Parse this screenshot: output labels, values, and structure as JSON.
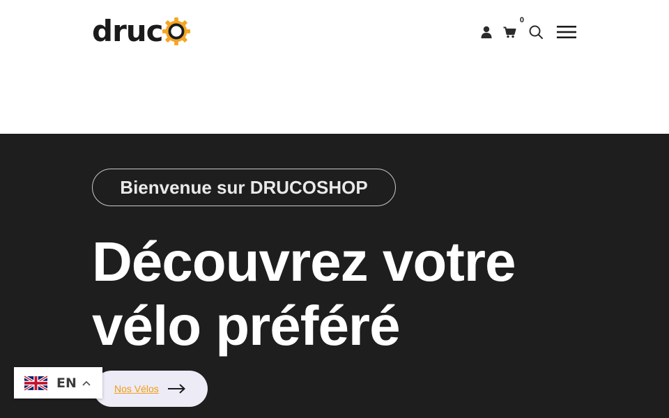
{
  "header": {
    "logo_text": "druc",
    "cart_count": "0"
  },
  "hero": {
    "welcome": "Bienvenue sur DRUCOSHOP",
    "title_line1": "Découvrez votre",
    "title_line2": "vélo préféré",
    "cta_label": "Nos Vélos "
  },
  "language": {
    "code": "EN",
    "flag": "uk-flag-icon"
  },
  "colors": {
    "brand_orange": "#f5a623",
    "hero_bg": "#1e1e1f",
    "cta_text": "#f39c12",
    "cta_bg": "#ecebf6"
  },
  "icons": {
    "user": "user-icon",
    "cart": "cart-icon",
    "search": "search-icon",
    "menu": "hamburger-menu-icon",
    "arrow": "arrow-right-icon",
    "chevron": "chevron-up-icon",
    "gear": "gear-logo-icon"
  }
}
